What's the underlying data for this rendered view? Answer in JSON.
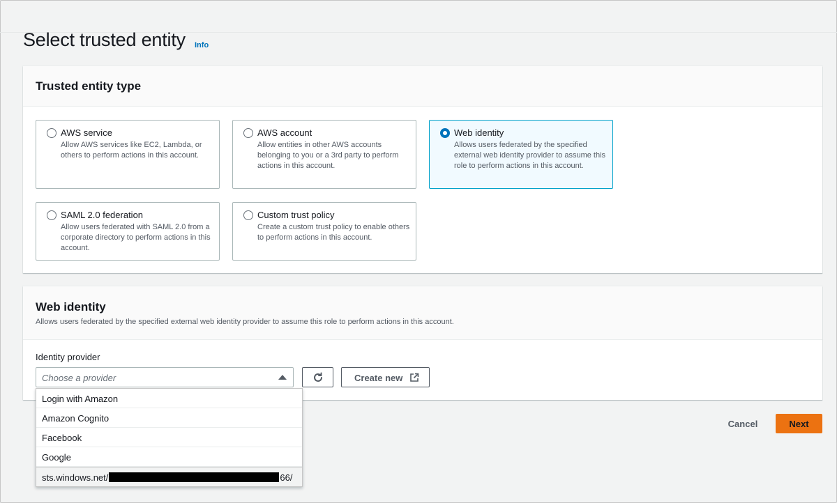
{
  "page": {
    "title": "Select trusted entity",
    "info_link": "Info"
  },
  "entity_type_panel": {
    "title": "Trusted entity type",
    "options": [
      {
        "label": "AWS service",
        "description": "Allow AWS services like EC2, Lambda, or others to perform actions in this account.",
        "selected": false
      },
      {
        "label": "AWS account",
        "description": "Allow entities in other AWS accounts belonging to you or a 3rd party to perform actions in this account.",
        "selected": false
      },
      {
        "label": "Web identity",
        "description": "Allows users federated by the specified external web identity provider to assume this role to perform actions in this account.",
        "selected": true
      },
      {
        "label": "SAML 2.0 federation",
        "description": "Allow users federated with SAML 2.0 from a corporate directory to perform actions in this account.",
        "selected": false
      },
      {
        "label": "Custom trust policy",
        "description": "Create a custom trust policy to enable others to perform actions in this account.",
        "selected": false
      }
    ]
  },
  "web_identity_panel": {
    "title": "Web identity",
    "description": "Allows users federated by the specified external web identity provider to assume this role to perform actions in this account.",
    "provider_label": "Identity provider",
    "provider_placeholder": "Choose a provider",
    "create_new_label": "Create new"
  },
  "provider_dropdown": {
    "options": [
      "Login with Amazon",
      "Amazon Cognito",
      "Facebook",
      "Google"
    ],
    "custom_option_prefix": "sts.windows.net/",
    "custom_option_suffix": "66/"
  },
  "footer": {
    "cancel_label": "Cancel",
    "next_label": "Next"
  },
  "colors": {
    "accent": "#0073bb",
    "primary_button": "#ec7211",
    "selected_tile_bg": "#f1faff"
  },
  "icons": {
    "refresh": "refresh-icon",
    "external_link": "external-link-icon",
    "caret": "caret-up-icon"
  }
}
